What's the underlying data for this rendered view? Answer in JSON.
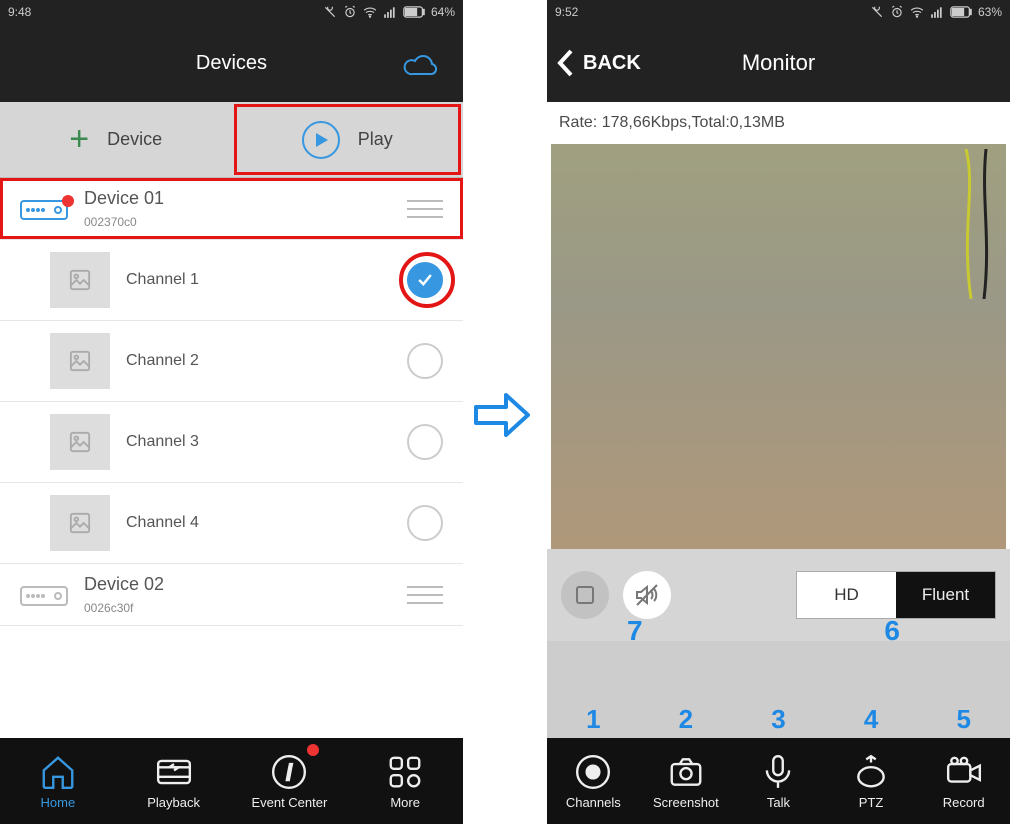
{
  "left": {
    "statusbar": {
      "time": "9:48",
      "battery": "64%"
    },
    "header": {
      "title": "Devices"
    },
    "actions": {
      "device": "Device",
      "play": "Play"
    },
    "devices": [
      {
        "name": "Device 01",
        "id": "002370c0",
        "online": true
      },
      {
        "name": "Device 02",
        "id": "0026c30f",
        "online": false
      }
    ],
    "channels": [
      {
        "name": "Channel 1",
        "selected": true
      },
      {
        "name": "Channel 2",
        "selected": false
      },
      {
        "name": "Channel 3",
        "selected": false
      },
      {
        "name": "Channel 4",
        "selected": false
      }
    ],
    "nav": {
      "home": "Home",
      "playback": "Playback",
      "event": "Event Center",
      "more": "More"
    }
  },
  "right": {
    "statusbar": {
      "time": "9:52",
      "battery": "63%"
    },
    "header": {
      "back": "BACK",
      "title": "Monitor"
    },
    "rate": "Rate: 178,66Kbps,Total:0,13MB",
    "quality": {
      "hd": "HD",
      "fluent": "Fluent"
    },
    "annot": {
      "a7": "7",
      "a6": "6",
      "n1": "1",
      "n2": "2",
      "n3": "3",
      "n4": "4",
      "n5": "5"
    },
    "nav": {
      "channels": "Channels",
      "screenshot": "Screenshot",
      "talk": "Talk",
      "ptz": "PTZ",
      "record": "Record"
    }
  }
}
